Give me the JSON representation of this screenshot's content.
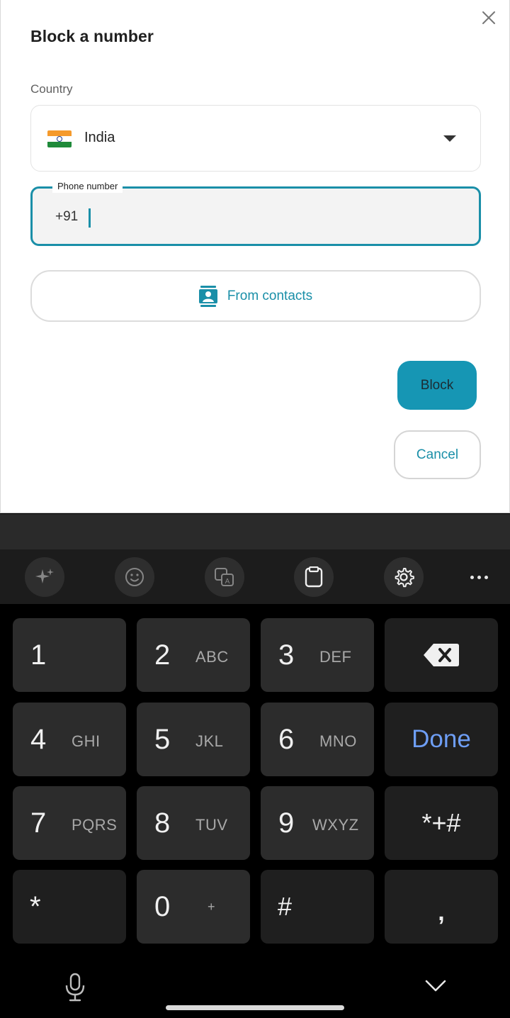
{
  "dialog": {
    "title": "Block a number",
    "country_label": "Country",
    "country": {
      "name": "India",
      "flag_icon": "india-flag-icon"
    },
    "phone": {
      "label": "Phone number",
      "prefix": "+91",
      "value": ""
    },
    "from_contacts_label": "From contacts",
    "block_label": "Block",
    "cancel_label": "Cancel",
    "accent_color": "#1a8fa8"
  },
  "keyboard": {
    "toolbar": [
      "sparkle-icon",
      "emoji-icon",
      "translate-icon",
      "clipboard-icon",
      "settings-icon",
      "more-icon"
    ],
    "keys": {
      "k1": {
        "digit": "1",
        "letters": ""
      },
      "k2": {
        "digit": "2",
        "letters": "ABC"
      },
      "k3": {
        "digit": "3",
        "letters": "DEF"
      },
      "k4": {
        "digit": "4",
        "letters": "GHI"
      },
      "k5": {
        "digit": "5",
        "letters": "JKL"
      },
      "k6": {
        "digit": "6",
        "letters": "MNO"
      },
      "k7": {
        "digit": "7",
        "letters": "PQRS"
      },
      "k8": {
        "digit": "8",
        "letters": "TUV"
      },
      "k9": {
        "digit": "9",
        "letters": "WXYZ"
      },
      "k0": {
        "digit": "0",
        "letters": "+"
      },
      "star": "*",
      "hash": "#",
      "comma": ",",
      "symbols": "*+#",
      "done": "Done"
    }
  }
}
